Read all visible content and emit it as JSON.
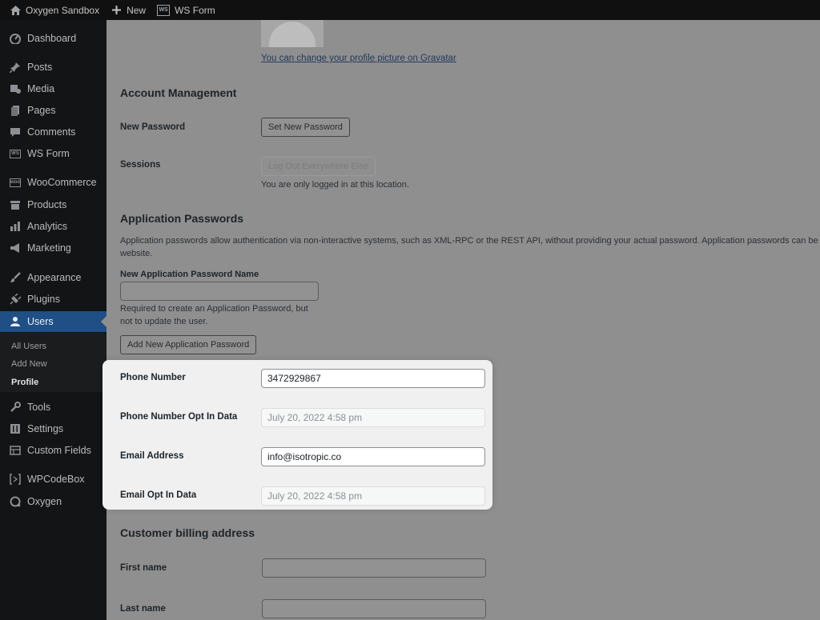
{
  "adminbar": {
    "site_name": "Oxygen Sandbox",
    "new_label": "New",
    "wsf_badge": "WS",
    "wsform_label": "WS Form"
  },
  "sidebar": {
    "items": [
      {
        "label": "Dashboard",
        "icon": "dashboard-icon"
      },
      {
        "label": "Posts",
        "icon": "pin-icon"
      },
      {
        "label": "Media",
        "icon": "media-icon"
      },
      {
        "label": "Pages",
        "icon": "pages-icon"
      },
      {
        "label": "Comments",
        "icon": "comment-icon"
      },
      {
        "label": "WS Form",
        "icon": "wsform-icon"
      },
      {
        "label": "WooCommerce",
        "icon": "woo-icon"
      },
      {
        "label": "Products",
        "icon": "archive-icon"
      },
      {
        "label": "Analytics",
        "icon": "bar-chart-icon"
      },
      {
        "label": "Marketing",
        "icon": "megaphone-icon"
      },
      {
        "label": "Appearance",
        "icon": "brush-icon"
      },
      {
        "label": "Plugins",
        "icon": "plug-icon"
      },
      {
        "label": "Users",
        "icon": "user-icon"
      },
      {
        "label": "Tools",
        "icon": "wrench-icon"
      },
      {
        "label": "Settings",
        "icon": "sliders-icon"
      },
      {
        "label": "Custom Fields",
        "icon": "table-icon"
      },
      {
        "label": "WPCodeBox",
        "icon": "code-box-icon"
      },
      {
        "label": "Oxygen",
        "icon": "oxygen-icon"
      }
    ],
    "badges": {
      "wsform": "WS",
      "woo": "woo"
    },
    "users_submenu": [
      "All Users",
      "Add New",
      "Profile"
    ]
  },
  "profile": {
    "gravatar_link": "You can change your profile picture on Gravatar"
  },
  "account_management": {
    "heading": "Account Management",
    "new_password_label": "New Password",
    "set_new_password_button": "Set New Password",
    "sessions_label": "Sessions",
    "logout_everywhere_button": "Log Out Everywhere Else",
    "sessions_note": "You are only logged in at this location."
  },
  "application_passwords": {
    "heading": "Application Passwords",
    "description_line1": "Application passwords allow authentication via non-interactive systems, such as XML-RPC or the REST API, without providing your actual password. Application passwords can be ea",
    "description_line2": "website.",
    "name_label": "New Application Password Name",
    "name_value": "",
    "help_line1": "Required to create an Application Password, but",
    "help_line2": "not to update the user.",
    "add_button": "Add New Application Password"
  },
  "custom_fields": {
    "phone_label": "Phone Number",
    "phone_value": "3472929867",
    "phone_optin_label": "Phone Number Opt In Data",
    "phone_optin_value": "July 20, 2022 4:58 pm",
    "email_label": "Email Address",
    "email_value": "info@isotropic.co",
    "email_optin_label": "Email Opt In Data",
    "email_optin_value": "July 20, 2022 4:58 pm"
  },
  "billing": {
    "heading": "Customer billing address",
    "first_name_label": "First name",
    "first_name_value": "",
    "last_name_label": "Last name",
    "last_name_value": ""
  }
}
